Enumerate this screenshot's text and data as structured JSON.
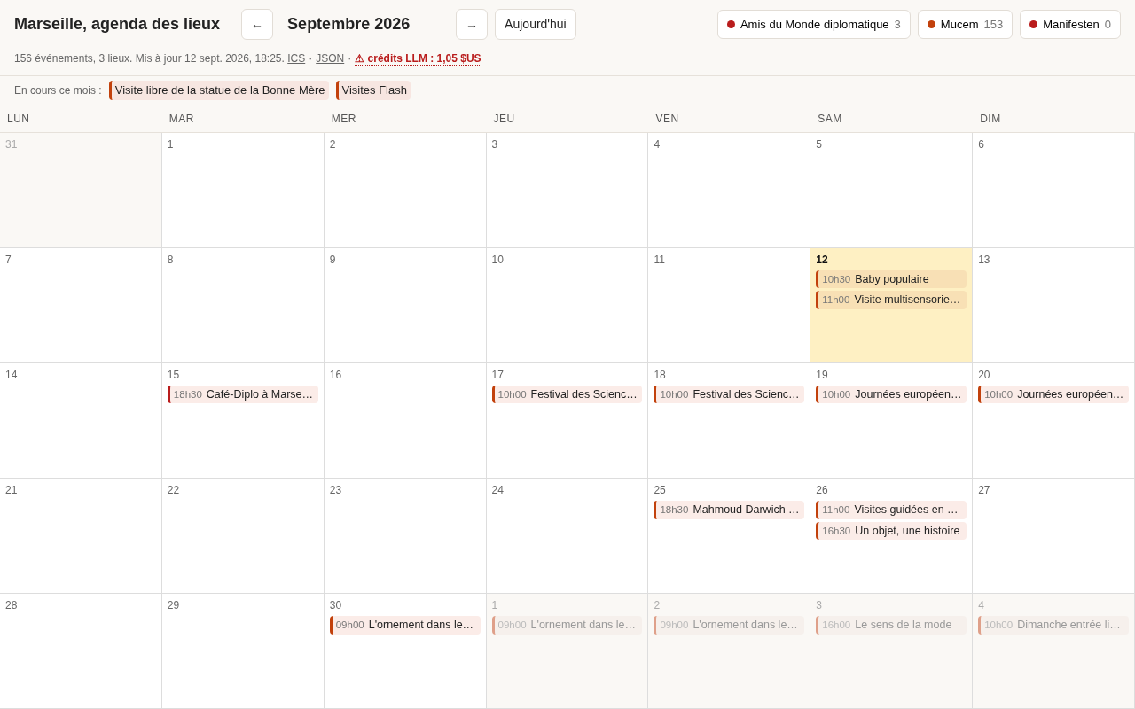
{
  "header": {
    "title": "Marseille, agenda des lieux",
    "prev": "←",
    "month": "Septembre 2026",
    "next": "→",
    "today_button": "Aujourd'hui"
  },
  "venues": [
    {
      "name": "Amis du Monde diplomatique",
      "count": "3",
      "color": "#b91c1c"
    },
    {
      "name": "Mucem",
      "count": "153",
      "color": "#c2410c"
    },
    {
      "name": "Manifesten",
      "count": "0",
      "color": "#b91c1c"
    }
  ],
  "info": {
    "summary": "156 événements, 3 lieux. Mis à jour 12 sept. 2026, 18:25.",
    "parts": [
      {
        "kind": "link",
        "text": "ICS"
      },
      {
        "kind": "sep",
        "text": "·"
      },
      {
        "kind": "link",
        "text": "JSON"
      },
      {
        "kind": "sep",
        "text": "·"
      }
    ],
    "warning_icon": "⚠",
    "warning": "crédits LLM : 1,05 $US"
  },
  "ongoing": {
    "label": "En cours ce mois :",
    "items": [
      {
        "title": "Visite libre de la statue de la Bonne Mère",
        "color": "#c2410c"
      },
      {
        "title": "Visites Flash",
        "color": "#c2410c"
      }
    ]
  },
  "weekdays": [
    "LUN",
    "MAR",
    "MER",
    "JEU",
    "VEN",
    "SAM",
    "DIM"
  ],
  "days": [
    {
      "day": "31",
      "outside": true,
      "today": false
    },
    {
      "day": "1",
      "outside": false,
      "today": false
    },
    {
      "day": "2",
      "outside": false,
      "today": false
    },
    {
      "day": "3",
      "outside": false,
      "today": false
    },
    {
      "day": "4",
      "outside": false,
      "today": false
    },
    {
      "day": "5",
      "outside": false,
      "today": false
    },
    {
      "day": "6",
      "outside": false,
      "today": false
    },
    {
      "day": "7",
      "outside": false,
      "today": false
    },
    {
      "day": "8",
      "outside": false,
      "today": false
    },
    {
      "day": "9",
      "outside": false,
      "today": false
    },
    {
      "day": "10",
      "outside": false,
      "today": false
    },
    {
      "day": "11",
      "outside": false,
      "today": false
    },
    {
      "day": "12",
      "outside": false,
      "today": true,
      "events": [
        {
          "time": "10h30",
          "title": "Baby populaire",
          "color": "#c2410c"
        },
        {
          "time": "11h00",
          "title": "Visite multisensorie…",
          "color": "#c2410c"
        }
      ]
    },
    {
      "day": "13",
      "outside": false,
      "today": false
    },
    {
      "day": "14",
      "outside": false,
      "today": false
    },
    {
      "day": "15",
      "outside": false,
      "today": false,
      "events": [
        {
          "time": "18h30",
          "title": "Café-Diplo à Marse…",
          "color": "#b91c1c"
        }
      ]
    },
    {
      "day": "16",
      "outside": false,
      "today": false
    },
    {
      "day": "17",
      "outside": false,
      "today": false,
      "events": [
        {
          "time": "10h00",
          "title": "Festival des Scienc…",
          "color": "#c2410c"
        }
      ]
    },
    {
      "day": "18",
      "outside": false,
      "today": false,
      "events": [
        {
          "time": "10h00",
          "title": "Festival des Scienc…",
          "color": "#c2410c"
        }
      ]
    },
    {
      "day": "19",
      "outside": false,
      "today": false,
      "events": [
        {
          "time": "10h00",
          "title": "Journées européen…",
          "color": "#c2410c"
        }
      ]
    },
    {
      "day": "20",
      "outside": false,
      "today": false,
      "events": [
        {
          "time": "10h00",
          "title": "Journées européen…",
          "color": "#c2410c"
        }
      ]
    },
    {
      "day": "21",
      "outside": false,
      "today": false
    },
    {
      "day": "22",
      "outside": false,
      "today": false
    },
    {
      "day": "23",
      "outside": false,
      "today": false
    },
    {
      "day": "24",
      "outside": false,
      "today": false
    },
    {
      "day": "25",
      "outside": false,
      "today": false,
      "events": [
        {
          "time": "18h30",
          "title": "Mahmoud Darwich …",
          "color": "#c2410c"
        }
      ]
    },
    {
      "day": "26",
      "outside": false,
      "today": false,
      "events": [
        {
          "time": "11h00",
          "title": "Visites guidées en …",
          "color": "#c2410c"
        },
        {
          "time": "16h30",
          "title": "Un objet, une histoire",
          "color": "#c2410c"
        }
      ]
    },
    {
      "day": "27",
      "outside": false,
      "today": false
    },
    {
      "day": "28",
      "outside": false,
      "today": false
    },
    {
      "day": "29",
      "outside": false,
      "today": false
    },
    {
      "day": "30",
      "outside": false,
      "today": false,
      "events": [
        {
          "time": "09h00",
          "title": "L'ornement dans le…",
          "color": "#c2410c"
        }
      ]
    },
    {
      "day": "1",
      "outside": true,
      "today": false,
      "events": [
        {
          "time": "09h00",
          "title": "L'ornement dans le…",
          "color": "#dfa08a"
        }
      ]
    },
    {
      "day": "2",
      "outside": true,
      "today": false,
      "events": [
        {
          "time": "09h00",
          "title": "L'ornement dans le…",
          "color": "#dfa08a"
        }
      ]
    },
    {
      "day": "3",
      "outside": true,
      "today": false,
      "events": [
        {
          "time": "16h00",
          "title": "Le sens de la mode",
          "color": "#dfa08a"
        }
      ]
    },
    {
      "day": "4",
      "outside": true,
      "today": false,
      "events": [
        {
          "time": "10h00",
          "title": "Dimanche entrée li…",
          "color": "#dfa08a"
        }
      ]
    }
  ]
}
